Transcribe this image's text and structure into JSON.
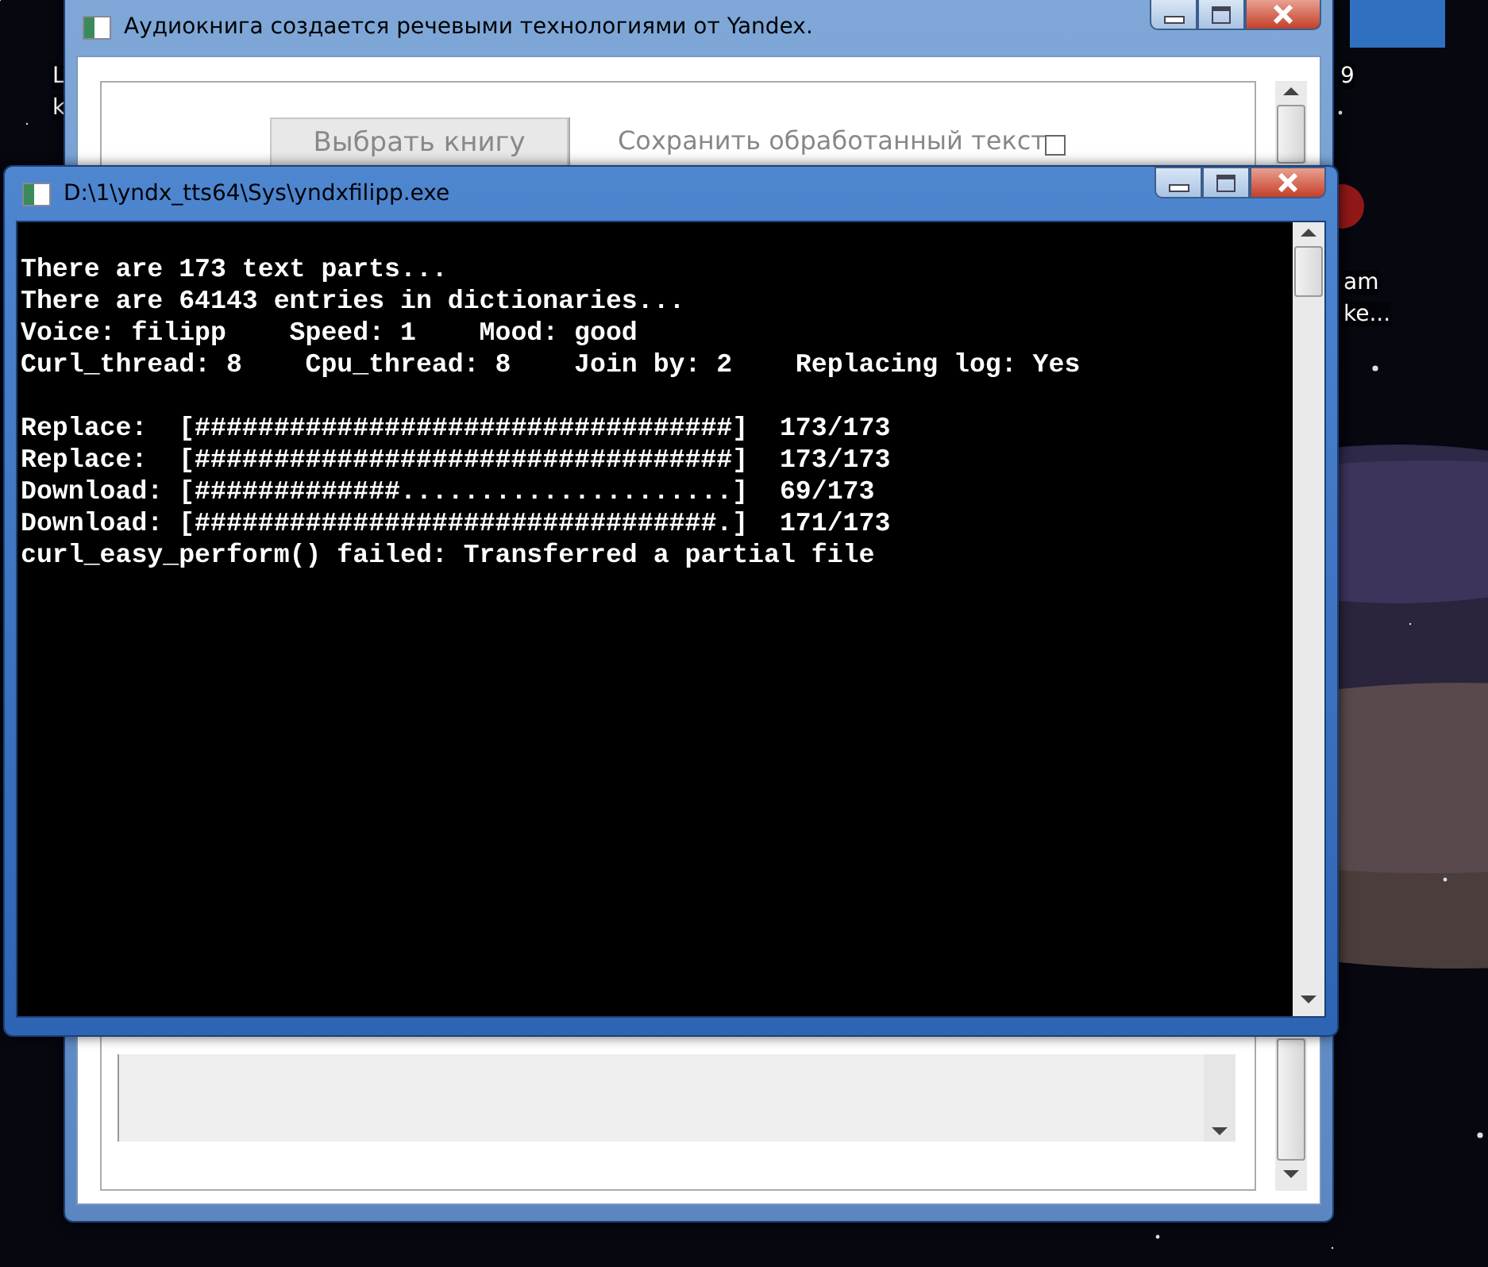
{
  "desktop": {
    "labels": [
      "L",
      "k",
      "9",
      "am",
      "ke..."
    ]
  },
  "back_window": {
    "title": "Аудиокнига создается речевыми технологиями от Yandex.",
    "choose_button": "Выбрать книгу",
    "save_option": {
      "label": "Сохранить обработанный текст",
      "checked": false
    }
  },
  "console_window": {
    "title": "D:\\1\\yndx_tts64\\Sys\\yndxfilipp.exe",
    "blocks": [
      [
        "There are 173 text parts...",
        "There are 64143 entries in dictionaries...",
        "Voice: filipp    Speed: 1    Mood: good",
        "Curl_thread: 8    Cpu_thread: 8    Join by: 2    Replacing log: Yes"
      ],
      [
        "Replace:  [##################################]  173/173",
        "Replace:  [##################################]  173/173",
        "Download: [#############.....................]  69/173",
        "Download: [#################################.]  171/173",
        "curl_easy_perform() failed: Transferred a partial file"
      ]
    ]
  }
}
